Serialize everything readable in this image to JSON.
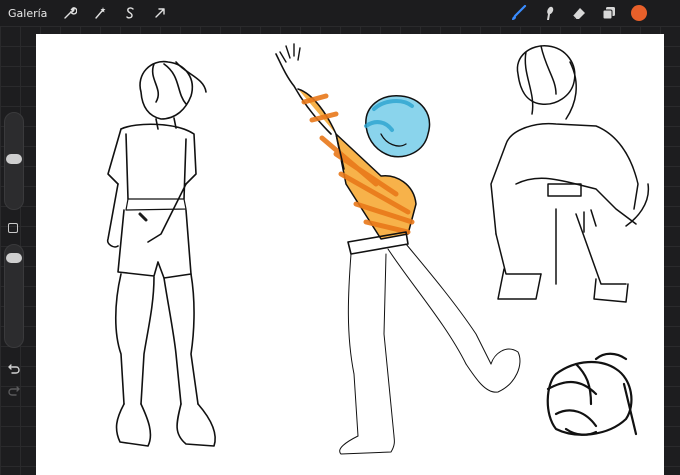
{
  "topbar": {
    "gallery_label": "Galería",
    "left_tools": [
      "wrench-icon",
      "magic-wand-icon",
      "selection-s-icon",
      "move-arrow-icon"
    ],
    "right_tools": [
      "brush-icon",
      "smudge-icon",
      "eraser-icon",
      "layers-icon"
    ],
    "active_tool": "brush-icon",
    "active_color": "#e8602a",
    "tool_accent": "#3a8cff"
  },
  "sidebar": {
    "brush_size_level": 0.48,
    "opacity_level": 0.15,
    "controls": [
      "brush-size-slider",
      "modify-button",
      "opacity-slider",
      "undo-button",
      "redo-button"
    ]
  },
  "canvas": {
    "background": "#ffffff",
    "sketch_colors": [
      "#111111",
      "#f08a1c",
      "#35b0d6"
    ]
  }
}
